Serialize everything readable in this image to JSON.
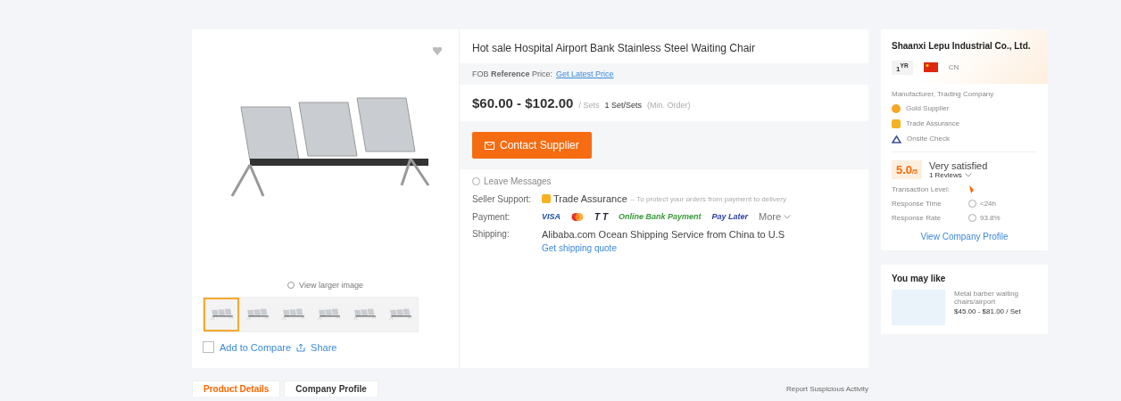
{
  "gallery": {
    "view_larger": "View larger image",
    "thumbnails": [
      {
        "selected": true
      },
      {
        "selected": false
      },
      {
        "selected": false
      },
      {
        "selected": false
      },
      {
        "selected": false
      },
      {
        "selected": false
      }
    ],
    "add_to_compare": {
      "label": "Add to Compare",
      "checked": false
    },
    "share": "Share"
  },
  "product": {
    "title": "Hot sale Hospital Airport Bank Stainless Steel Waiting Chair",
    "reference_price": "FOB **Reference** Price:",
    "latest_price_link": "Get Latest Price",
    "price": "$60.00 - $102.00",
    "unit": "/ Sets",
    "min_order": "1 Set/Sets",
    "min_order_note": "(Min. Order)",
    "contact_button": "Contact Supplier",
    "leave_messages": "Leave Messages",
    "seller_support_label": "Seller Support:",
    "seller_support": "Trade Assurance",
    "seller_support_note": "– To protect your orders from payment to delivery",
    "payment_label": "Payment:",
    "payment_methods": [
      {
        "kind": "visa",
        "text": "VISA"
      },
      {
        "kind": "card"
      },
      {
        "kind": "tt",
        "text": "T T"
      },
      {
        "kind": "bank",
        "text": "Online Bank Payment"
      },
      {
        "kind": "later",
        "text": "Pay Later"
      },
      {
        "kind": "more",
        "text": "More"
      }
    ],
    "shipping_label": "Shipping:",
    "shipping": "Alibaba.com Ocean Shipping Service from China to U.S",
    "shipping_link": "Get shipping quote"
  },
  "tabs": [
    {
      "label": "Product Details",
      "selected": true
    },
    {
      "label": "Company Profile",
      "selected": false
    }
  ],
  "report_link": "Report Suspicious Activity",
  "supplier": {
    "name": "Shaanxi Lepu Industrial Co., Ltd.",
    "years": "1",
    "years_unit": "YR",
    "country": "CN",
    "business_type": "Manufacturer, Trading Company",
    "badges": [
      {
        "kind": "gold",
        "text": "Gold Supplier"
      },
      {
        "kind": "trade",
        "text": "Trade Assurance"
      },
      {
        "kind": "onsite",
        "text": "Onsite Check"
      }
    ],
    "rating": "5.0",
    "rating_max": "/5",
    "rating_text": "Very satisfied",
    "reviews": "1 Reviews",
    "stats": [
      {
        "kind": "level",
        "label": "Transaction Level:"
      },
      {
        "kind": "time",
        "label": "Response Time",
        "value": "<24h"
      },
      {
        "kind": "rate",
        "label": "Response Rate",
        "value": "93.8%"
      }
    ],
    "profile_link": "View Company Profile"
  },
  "you_may_like": {
    "title": "You may like",
    "items": [
      {
        "name": "Metal barber waiting chairs/airport",
        "price": "$45.00 - $81.00 / Set"
      }
    ]
  }
}
